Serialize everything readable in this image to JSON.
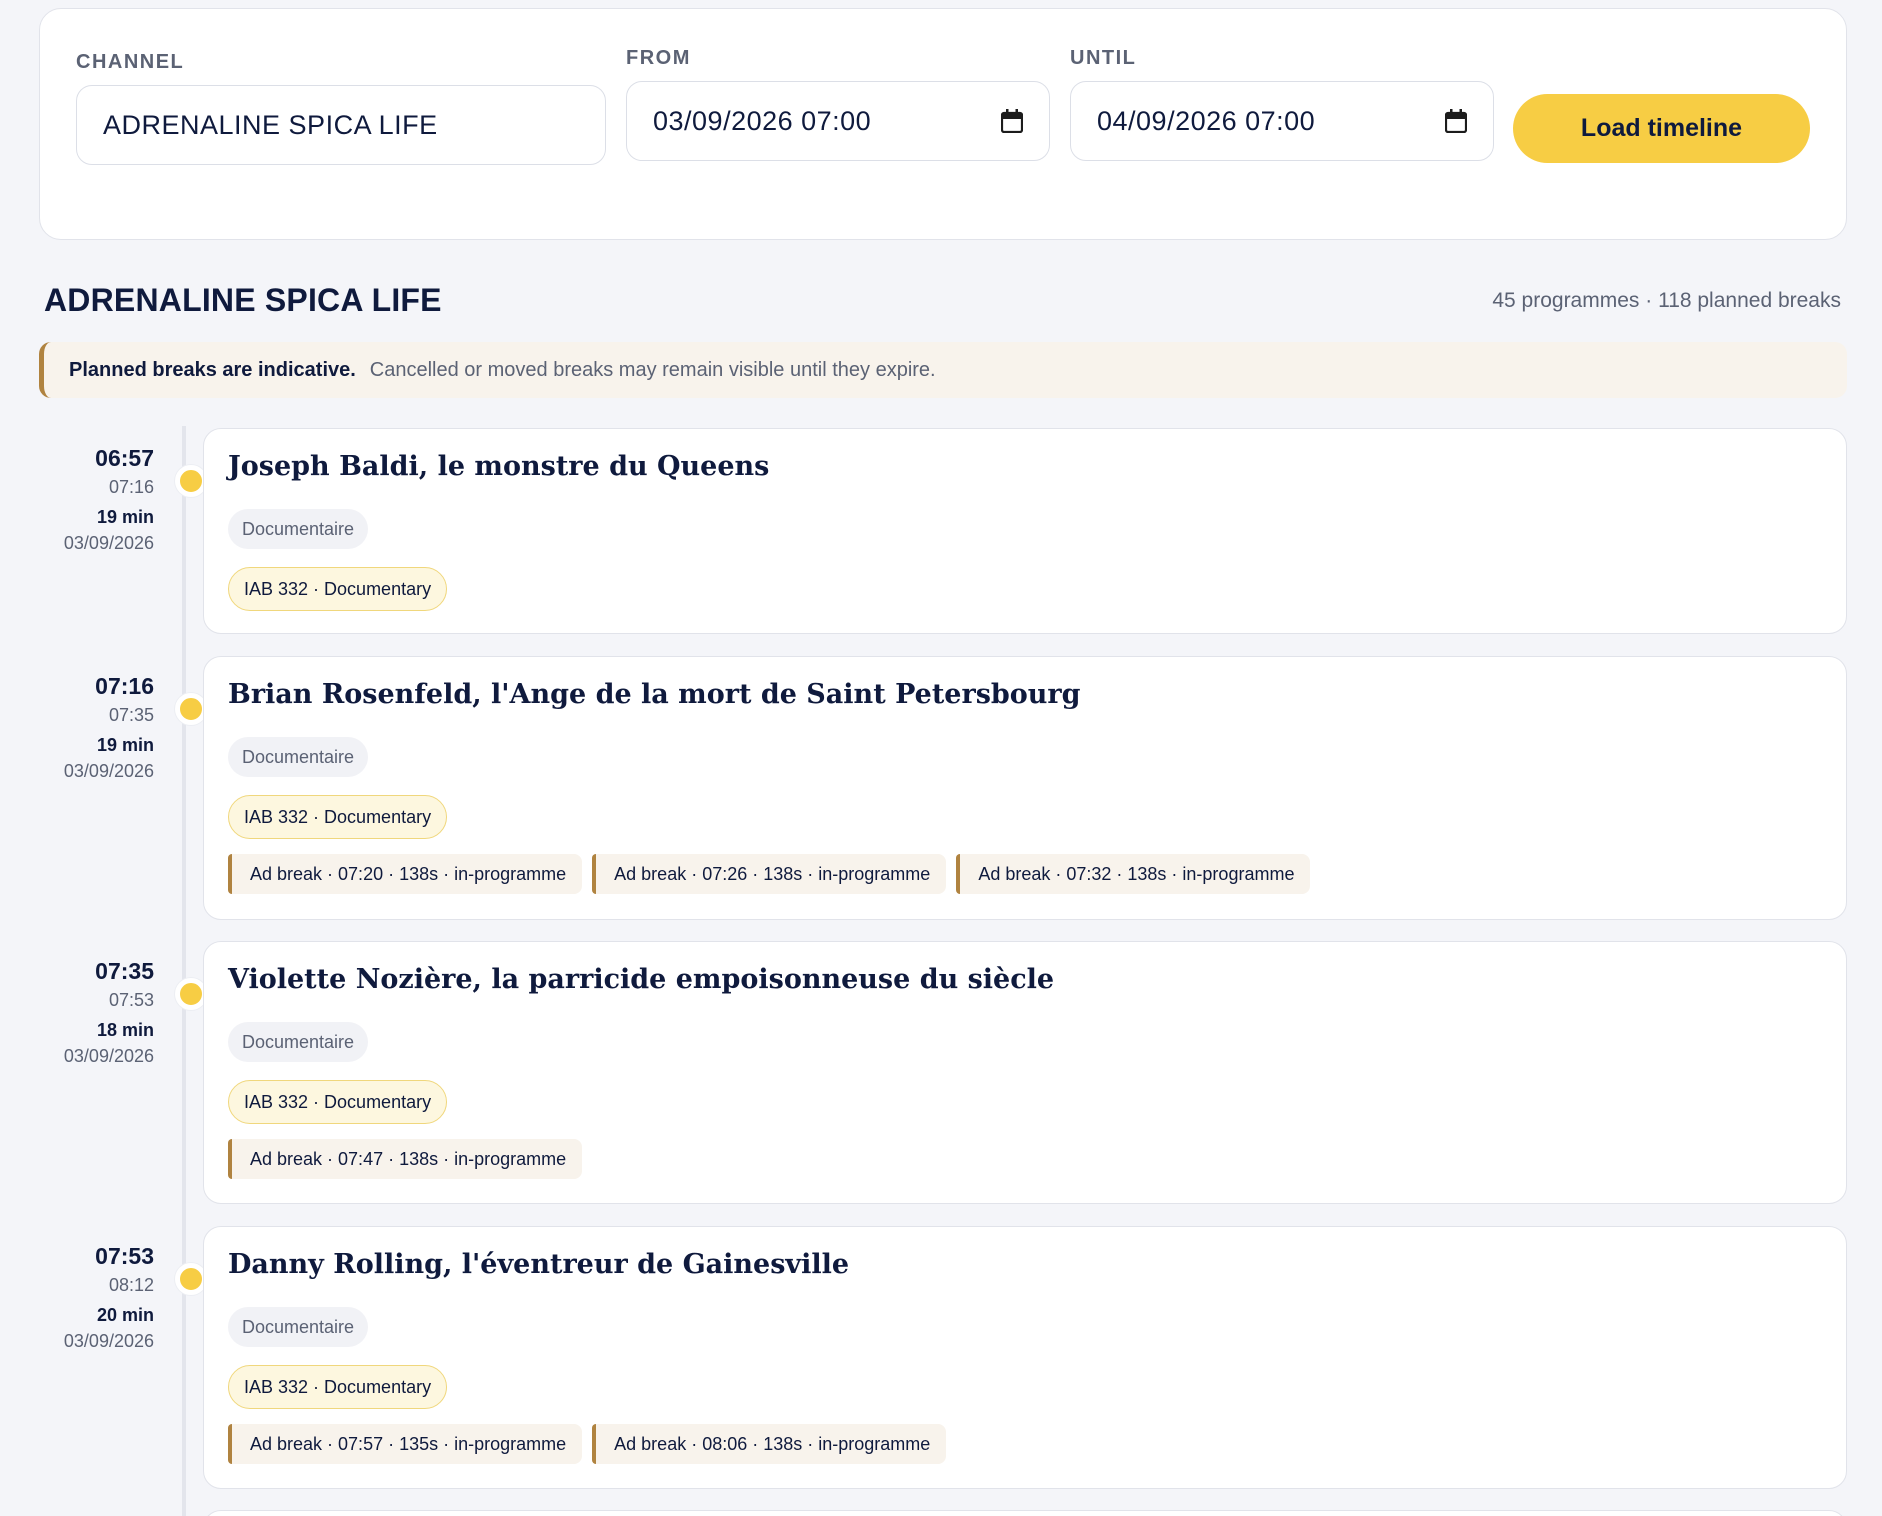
{
  "filters": {
    "channel_label": "CHANNEL",
    "channel_value": "ADRENALINE SPICA LIFE",
    "from_label": "FROM",
    "from_value": "03/09/2026  07:00",
    "until_label": "UNTIL",
    "until_value": "04/09/2026  07:00",
    "load_button": "Load timeline"
  },
  "header": {
    "channel_title": "ADRENALINE SPICA LIFE",
    "counts": "45 programmes · 118 planned breaks"
  },
  "notice": {
    "bold": "Planned breaks are indicative.",
    "text": "Cancelled or moved breaks may remain visible until they expire."
  },
  "programmes": [
    {
      "start": "06:57",
      "end": "07:16",
      "duration": "19 min",
      "date": "03/09/2026",
      "title": "Joseph Baldi, le monstre du Queens",
      "genre": "Documentaire",
      "iab": "IAB 332 · Documentary",
      "breaks": []
    },
    {
      "start": "07:16",
      "end": "07:35",
      "duration": "19 min",
      "date": "03/09/2026",
      "title": "Brian Rosenfeld, l'Ange de la mort de Saint Petersbourg",
      "genre": "Documentaire",
      "iab": "IAB 332 · Documentary",
      "breaks": [
        "Ad break · 07:20 · 138s · in-programme",
        "Ad break · 07:26 · 138s · in-programme",
        "Ad break · 07:32 · 138s · in-programme"
      ]
    },
    {
      "start": "07:35",
      "end": "07:53",
      "duration": "18 min",
      "date": "03/09/2026",
      "title": "Violette Nozière, la parricide empoisonneuse du siècle",
      "genre": "Documentaire",
      "iab": "IAB 332 · Documentary",
      "breaks": [
        "Ad break · 07:47 · 138s · in-programme"
      ]
    },
    {
      "start": "07:53",
      "end": "08:12",
      "duration": "20 min",
      "date": "03/09/2026",
      "title": "Danny Rolling, l'éventreur de Gainesville",
      "genre": "Documentaire",
      "iab": "IAB 332 · Documentary",
      "breaks": [
        "Ad break · 07:57 · 135s · in-programme",
        "Ad break · 08:06 · 138s · in-programme"
      ]
    }
  ],
  "icons": {
    "calendar": "calendar-icon"
  },
  "colors": {
    "accent": "#f7cd44",
    "break_border": "#b08340",
    "text": "#0f1a3d"
  }
}
